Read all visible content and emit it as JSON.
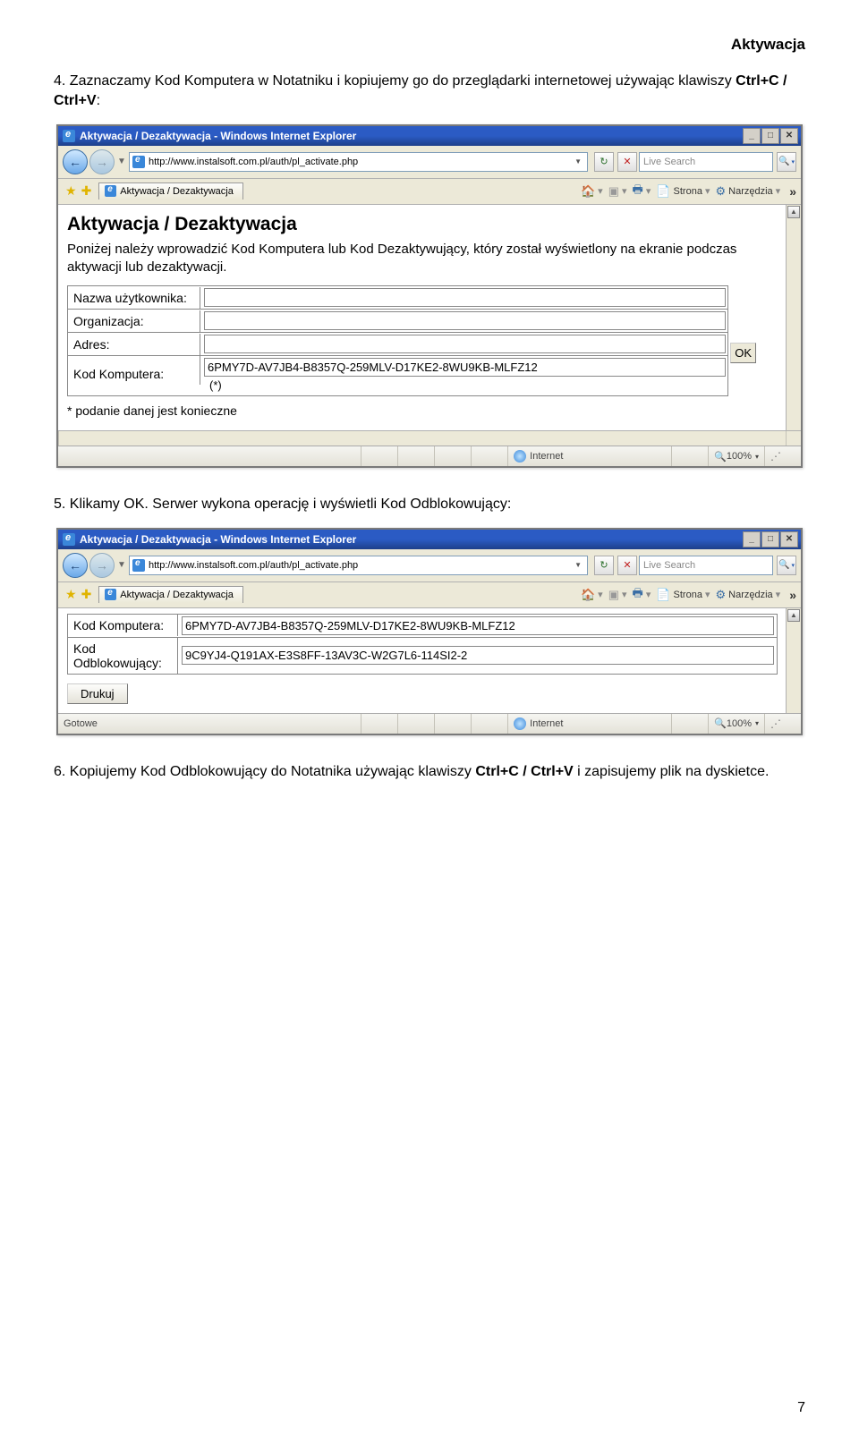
{
  "header": {
    "title": "Aktywacja"
  },
  "step4": {
    "num": "4.",
    "text_a": " Zaznaczamy Kod Komputera w Notatniku i kopiujemy go do przeglądarki internetowej używając klawiszy ",
    "bold": "Ctrl+C / Ctrl+V",
    "text_b": ":"
  },
  "browser1": {
    "title": "Aktywacja / Dezaktywacja - Windows Internet Explorer",
    "url": "http://www.instalsoft.com.pl/auth/pl_activate.php",
    "search_placeholder": "Live Search",
    "tab": "Aktywacja / Dezaktywacja",
    "tool_strona": "Strona",
    "tool_narzedzia": "Narzędzia",
    "page_h1": "Aktywacja / Dezaktywacja",
    "page_desc": "Poniżej należy wprowadzić Kod Komputera lub Kod Dezaktywujący, który został wyświetlony na ekranie podczas aktywacji lub dezaktywacji.",
    "label_user": "Nazwa użytkownika:",
    "label_org": "Organizacja:",
    "label_addr": "Adres:",
    "label_kod": "Kod Komputera:",
    "kod_value": "6PMY7D-AV7JB4-B8357Q-259MLV-D17KE2-8WU9KB-MLFZ12",
    "asterisk": "(*)",
    "footnote": "* podanie danej jest konieczne",
    "ok": "OK",
    "internet": "Internet",
    "zoom": "100%"
  },
  "step5": {
    "num": "5.",
    "text": " Klikamy OK. Serwer wykona operację i wyświetli Kod Odblokowujący:"
  },
  "browser2": {
    "title": "Aktywacja / Dezaktywacja - Windows Internet Explorer",
    "url": "http://www.instalsoft.com.pl/auth/pl_activate.php",
    "search_placeholder": "Live Search",
    "tab": "Aktywacja / Dezaktywacja",
    "tool_strona": "Strona",
    "tool_narzedzia": "Narzędzia",
    "label_kod": "Kod Komputera:",
    "kod_value": "6PMY7D-AV7JB4-B8357Q-259MLV-D17KE2-8WU9KB-MLFZ12",
    "label_unlock": "Kod Odblokowujący:",
    "unlock_value": "9C9YJ4-Q191AX-E3S8FF-13AV3C-W2G7L6-114SI2-2",
    "print": "Drukuj",
    "gotowe": "Gotowe",
    "internet": "Internet",
    "zoom": "100%"
  },
  "step6": {
    "num": "6.",
    "text_a": " Kopiujemy Kod Odblokowujący do Notatnika używając klawiszy ",
    "bold": "Ctrl+C / Ctrl+V",
    "text_b": "  i zapisujemy plik na dyskietce."
  },
  "page_number": "7"
}
